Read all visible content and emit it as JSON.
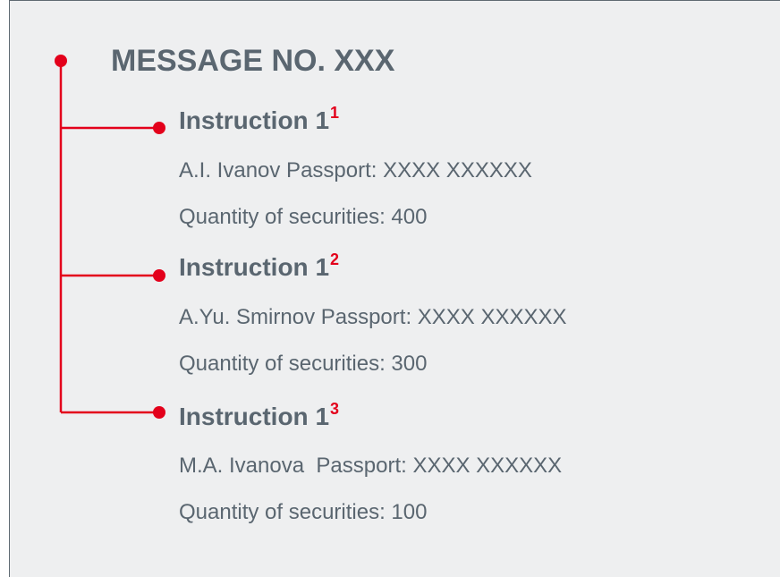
{
  "title": "MESSAGE NO. XXX",
  "accent_color": "#e3001b",
  "text_color": "#5a6670",
  "instructions": [
    {
      "title": "Instruction 1",
      "superscript": "1",
      "passport_line": "A.I. Ivanov Passport: XXXX XXXXXX",
      "quantity_line": "Quantity of securities: 400"
    },
    {
      "title": "Instruction 1",
      "superscript": "2",
      "passport_line": "A.Yu. Smirnov Passport: XXXX XXXXXX",
      "quantity_line": "Quantity of securities: 300"
    },
    {
      "title": "Instruction 1",
      "superscript": "3",
      "passport_line": "M.A. Ivanova  Passport: XXXX XXXXXX",
      "quantity_line": "Quantity of securities: 100"
    }
  ]
}
